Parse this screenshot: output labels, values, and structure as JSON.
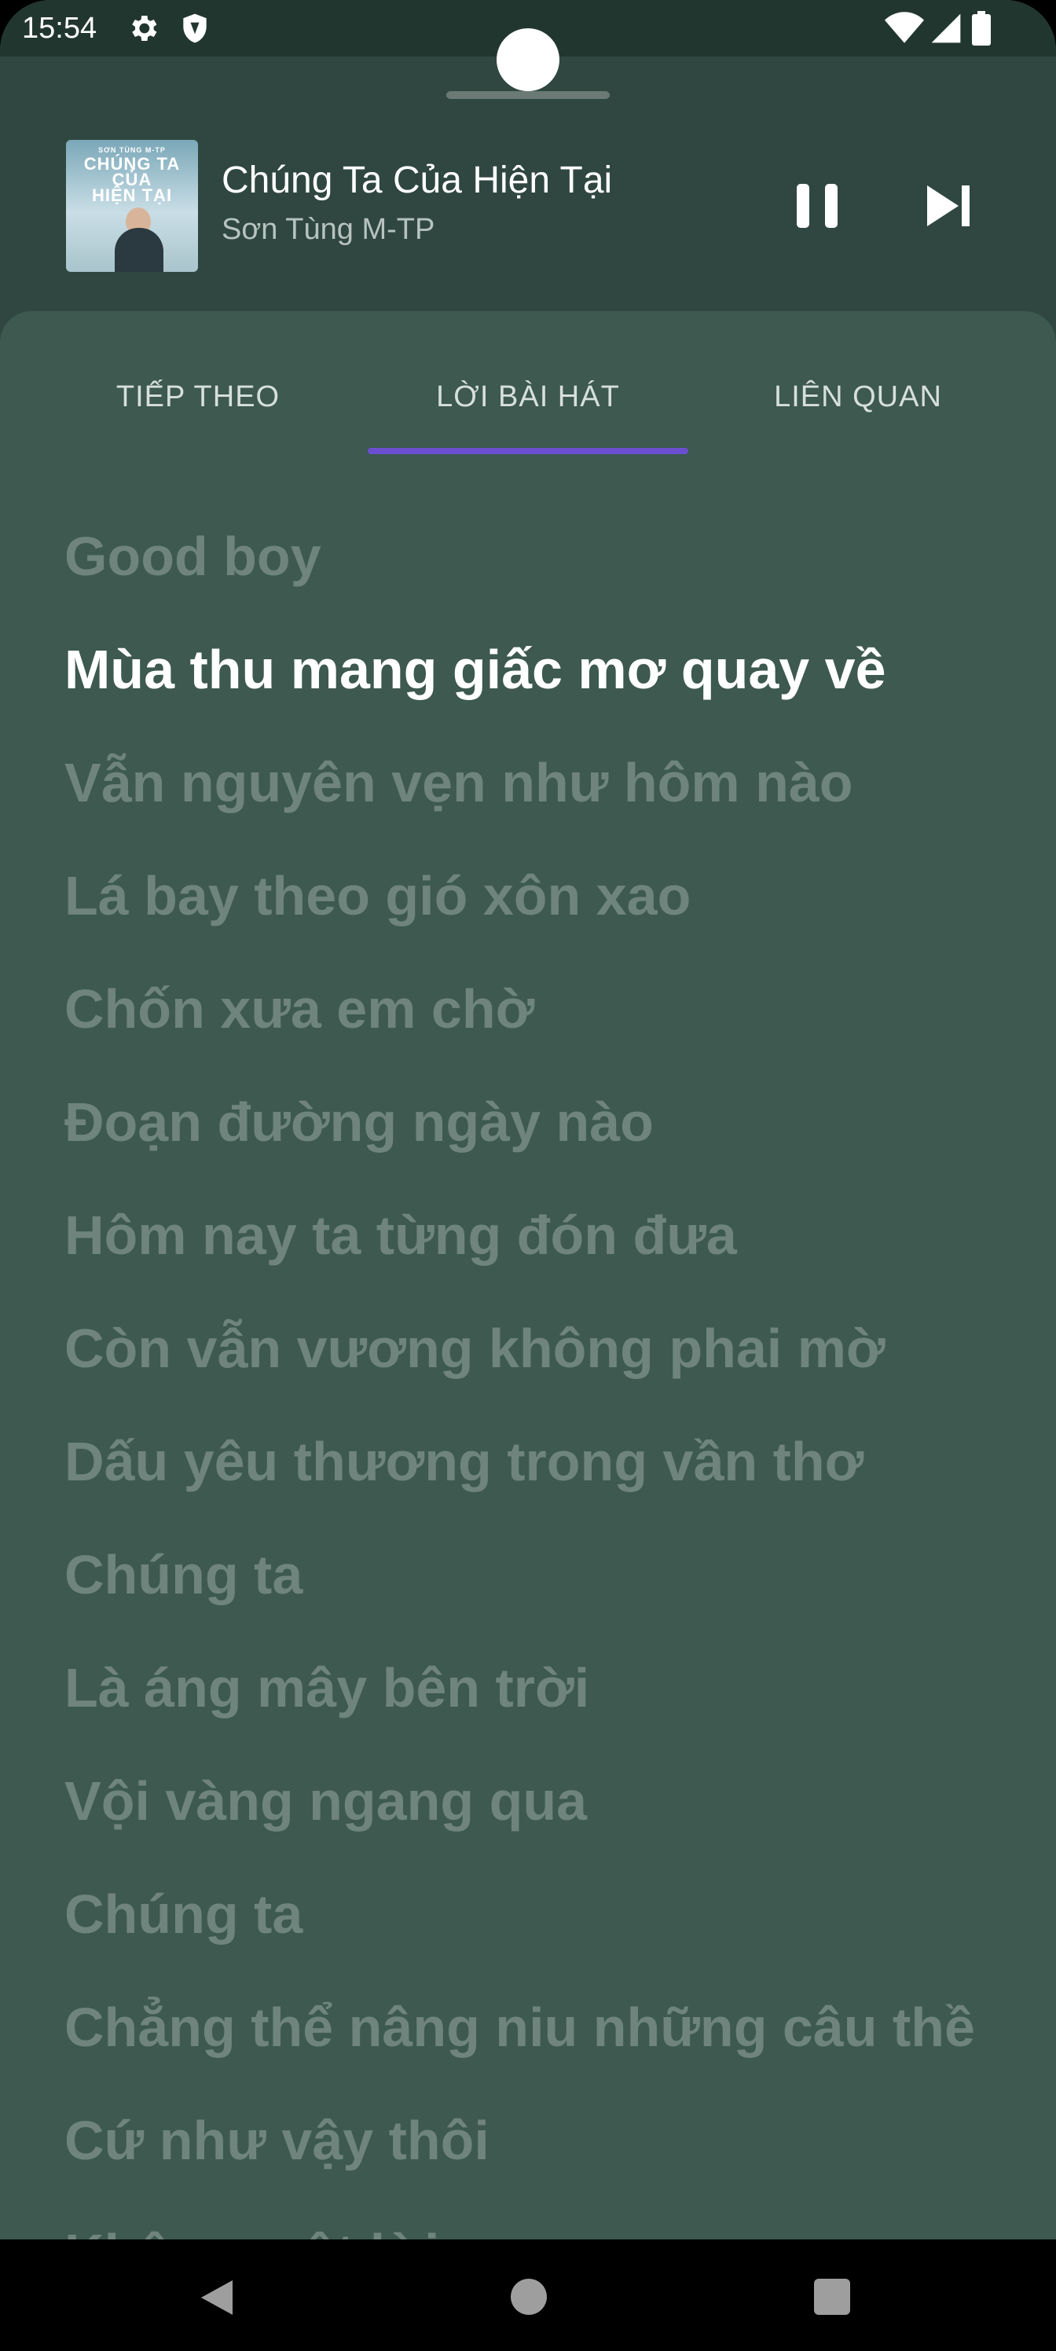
{
  "status_bar": {
    "time": "15:54",
    "icons_left": [
      "gear-icon",
      "shield-icon"
    ],
    "icons_right": [
      "wifi-icon",
      "signal-icon",
      "battery-icon"
    ]
  },
  "now_playing": {
    "album_art_text": [
      "SƠN TÙNG M-TP",
      "CHÚNG TA",
      "CỦA",
      "HIỆN TẠI"
    ],
    "title": "Chúng Ta Của Hiện Tại",
    "artist": "Sơn Tùng M-TP",
    "pause_icon": "pause-icon",
    "next_icon": "skip-next-icon"
  },
  "tabs": [
    {
      "label": "TIẾP THEO"
    },
    {
      "label": "LỜI BÀI HÁT"
    },
    {
      "label": "LIÊN QUAN"
    }
  ],
  "active_tab_index": 1,
  "lyrics": [
    "Good boy",
    "Mùa thu mang giấc mơ quay về",
    "Vẫn nguyên vẹn như hôm nào",
    "Lá bay theo gió xôn xao",
    "Chốn xưa em chờ",
    "Đoạn đường ngày nào",
    "Hôm nay ta từng đón đưa",
    "Còn vẫn vương không phai mờ",
    "Dấu yêu thương trong vần thơ",
    "Chúng ta",
    "Là áng mây bên trời",
    "Vội vàng ngang qua",
    "Chúng ta",
    "Chẳng thể nâng niu những câu thề",
    "Cứ như vậy thôi",
    "Không một lời"
  ],
  "active_lyric_index": 1,
  "colors": {
    "background": "#2f4740",
    "sheet": "#3d5950",
    "accent": "#6b4fd0",
    "inactive_lyric": "#6e847d",
    "active_lyric": "#ffffff"
  },
  "nav_bar": {
    "back_icon": "back-triangle-icon",
    "home_icon": "home-circle-icon",
    "recents_icon": "recents-square-icon"
  }
}
